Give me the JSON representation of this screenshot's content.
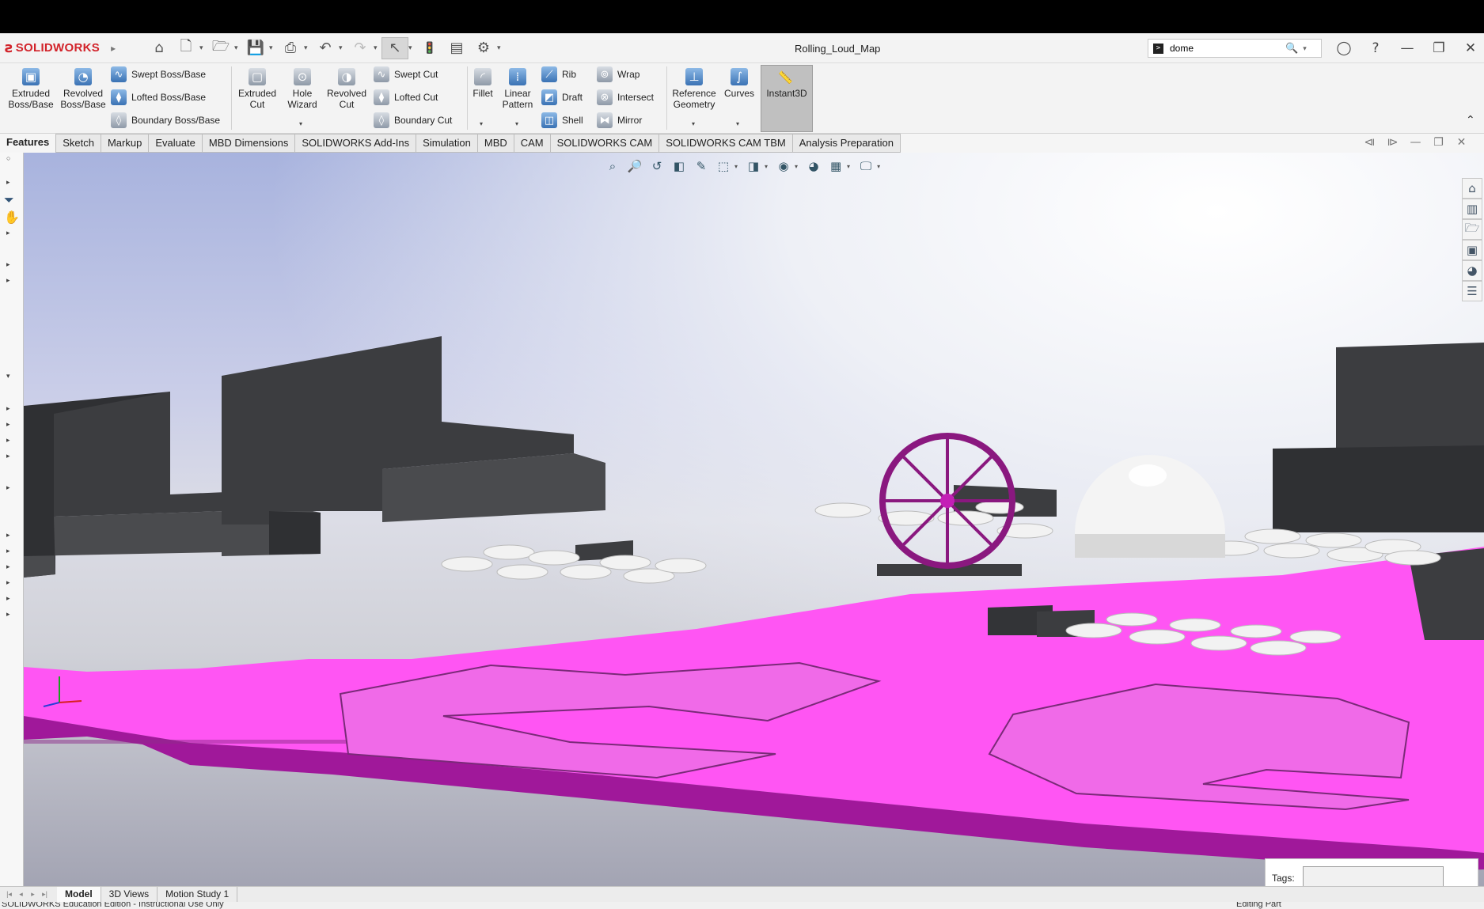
{
  "app": {
    "brand": "SOLIDWORKS",
    "document_title": "Rolling_Loud_Map"
  },
  "search": {
    "value": "dome"
  },
  "ribbon": {
    "extruded_boss": "Extruded Boss/Base",
    "revolved_boss": "Revolved Boss/Base",
    "swept_boss": "Swept Boss/Base",
    "lofted_boss": "Lofted Boss/Base",
    "boundary_boss": "Boundary Boss/Base",
    "extruded_cut": "Extruded Cut",
    "hole_wizard": "Hole Wizard",
    "revolved_cut": "Revolved Cut",
    "swept_cut": "Swept Cut",
    "lofted_cut": "Lofted Cut",
    "boundary_cut": "Boundary Cut",
    "fillet": "Fillet",
    "linear_pattern": "Linear Pattern",
    "rib": "Rib",
    "draft": "Draft",
    "shell": "Shell",
    "wrap": "Wrap",
    "intersect": "Intersect",
    "mirror": "Mirror",
    "reference_geometry": "Reference Geometry",
    "curves": "Curves",
    "instant3d": "Instant3D"
  },
  "command_tabs": [
    "Features",
    "Sketch",
    "Markup",
    "Evaluate",
    "MBD Dimensions",
    "SOLIDWORKS Add-Ins",
    "Simulation",
    "MBD",
    "CAM",
    "SOLIDWORKS CAM",
    "SOLIDWORKS CAM TBM",
    "Analysis Preparation"
  ],
  "tags": {
    "label": "Tags:"
  },
  "bottom_tabs": [
    "Model",
    "3D Views",
    "Motion Study 1"
  ],
  "status": {
    "left": "SOLIDWORKS Education Edition - Instructional Use Only",
    "right": "Editing Part"
  },
  "colors": {
    "ground": "#ff55f3",
    "ground_side": "#a0189a",
    "buildings": "#3c3d40",
    "accent_red": "#d2232a"
  }
}
